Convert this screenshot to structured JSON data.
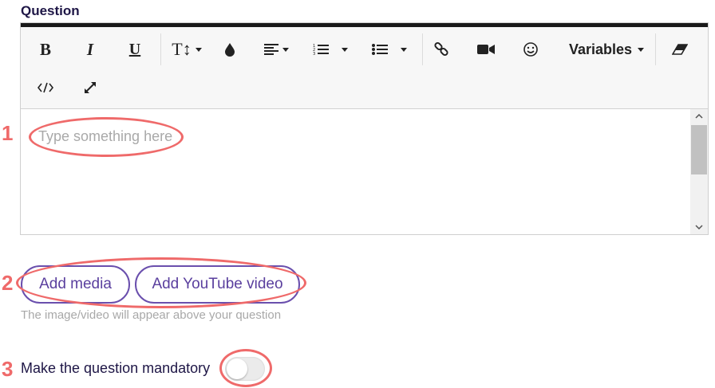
{
  "question": {
    "label": "Question"
  },
  "toolbar": {
    "bold_label": "B",
    "italic_label": "I",
    "underline_label": "U",
    "text_size_label": "T↕",
    "variables_label": "Variables"
  },
  "editor": {
    "placeholder": "Type something here"
  },
  "media": {
    "add_media_label": "Add media",
    "add_youtube_label": "Add YouTube video",
    "hint": "The image/video will appear above your question"
  },
  "mandatory": {
    "label": "Make the question mandatory",
    "enabled": false
  },
  "annotations": {
    "one": "1",
    "two": "2",
    "three": "3"
  },
  "colors": {
    "accent": "#6a4fad",
    "annotation": "#ef6a6a",
    "label": "#1e1646",
    "placeholder": "#a9a9a9"
  }
}
